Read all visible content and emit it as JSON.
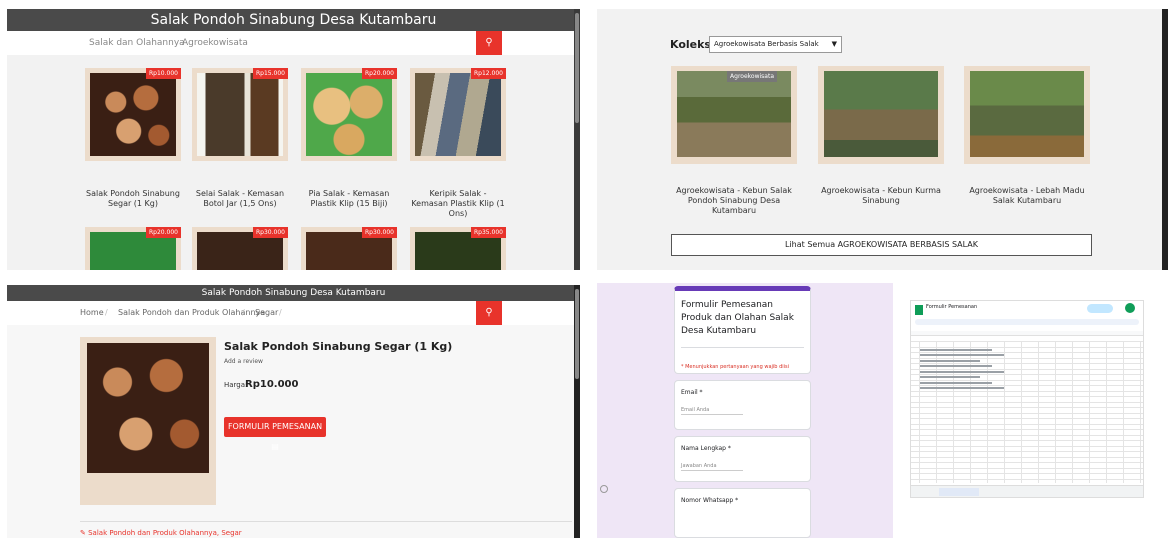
{
  "shop": {
    "title": "Salak Pondoh Sinabung Desa Kutambaru",
    "nav": [
      "Salak dan Olahannya",
      "Agroekowisata"
    ],
    "products": [
      {
        "name": "Salak Pondoh Sinabung Segar (1 Kg)",
        "price": "Rp10.000"
      },
      {
        "name": "Selai Salak - Kemasan Botol Jar (1,5 Ons)",
        "price": "Rp15.000"
      },
      {
        "name": "Pia Salak - Kemasan Plastik Klip (15 Biji)",
        "price": "Rp20.000"
      },
      {
        "name": "Keripik Salak - Kemasan Plastik Klip (1 Ons)",
        "price": "Rp12.000"
      }
    ],
    "second_row_prices": [
      "Rp20.000",
      "Rp30.000",
      "Rp30.000",
      "Rp35.000"
    ]
  },
  "collection": {
    "label": "Koleksi",
    "selected": "Agroekowisata Berbasis Salak",
    "badge": "Agroekowisata",
    "items": [
      "Agroekowisata - Kebun Salak Pondoh Sinabung Desa Kutambaru",
      "Agroekowisata - Kebun Kurma Sinabung",
      "Agroekowisata - Lebah Madu Salak Kutambaru"
    ],
    "see_all": "Lihat Semua AGROEKOWISATA BERBASIS SALAK"
  },
  "detail": {
    "title": "Salak Pondoh Sinabung Desa Kutambaru",
    "breadcrumbs": [
      "Home",
      "/",
      "Salak Pondoh dan Produk Olahannya",
      "/",
      "Segar",
      "/"
    ],
    "product_name": "Salak Pondoh Sinabung Segar (1 Kg)",
    "review": "Add a review",
    "price_label": "Harga:",
    "price": "Rp10.000",
    "order_button": "FORMULIR PEMESANAN",
    "tags": "Salak Pondoh dan Produk Olahannya, Segar"
  },
  "form": {
    "title": "Formulir Pemesanan Produk dan Olahan Salak Desa Kutambaru",
    "required_note": "* Menunjukkan pertanyaan yang wajib diisi",
    "fields": [
      "Email *",
      "Nama Lengkap *",
      "Nomor Whatsapp *"
    ],
    "placeholders": [
      "Email Anda",
      "Jawaban Anda"
    ]
  },
  "sheet": {
    "title": "Formulir Pemesanan"
  },
  "colors": {
    "accent": "#e8332b",
    "header": "#4a4a4a",
    "frame": "#ecdccb",
    "form_purple": "#673ab7"
  }
}
